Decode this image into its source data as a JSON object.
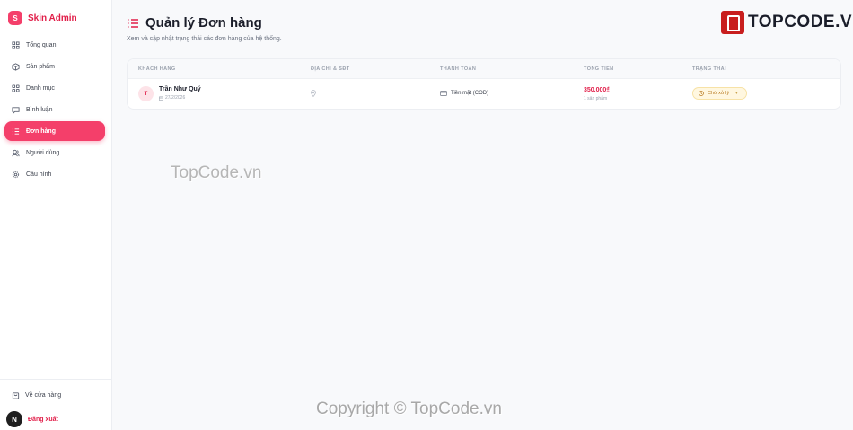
{
  "brand": {
    "logo_letter": "S",
    "name": "Skin Admin"
  },
  "nav": [
    {
      "label": "Tổng quan",
      "icon": "grid-icon",
      "active": false
    },
    {
      "label": "Sản phẩm",
      "icon": "box-icon",
      "active": false
    },
    {
      "label": "Danh mục",
      "icon": "category-grid-icon",
      "active": false
    },
    {
      "label": "Bình luận",
      "icon": "comment-icon",
      "active": false
    },
    {
      "label": "Đơn hàng",
      "icon": "list-icon",
      "active": true
    },
    {
      "label": "Người dùng",
      "icon": "users-icon",
      "active": false
    },
    {
      "label": "Cấu hình",
      "icon": "gear-icon",
      "active": false
    }
  ],
  "sidebar_bottom": {
    "back_label": "Về cửa hàng",
    "logout_label": "Đăng xuất",
    "avatar_letter": "N"
  },
  "header": {
    "title": "Quản lý Đơn hàng",
    "subtitle": "Xem và cập nhật trạng thái các đơn hàng của hệ thống."
  },
  "table": {
    "columns": [
      "KHÁCH HÀNG",
      "ĐỊA CHỈ & SĐT",
      "THANH TOÁN",
      "TỔNG TIỀN",
      "TRẠNG THÁI"
    ],
    "rows": [
      {
        "avatar": "T",
        "customer": "Trần Như Quý",
        "date": "27/2/2026",
        "payment": "Tiền mặt (COD)",
        "total": "350.000₫",
        "quantity": "1 sản phẩm",
        "status": "Chờ xử lý"
      }
    ]
  },
  "colors": {
    "accent": "#f43f6a",
    "accent_dark": "#e11d48",
    "status_pending": "#b7791f"
  },
  "overlays": {
    "logo_text": "TOPCODE.VN",
    "watermark_1": "TopCode.vn",
    "watermark_2": "Copyright © TopCode.vn"
  }
}
